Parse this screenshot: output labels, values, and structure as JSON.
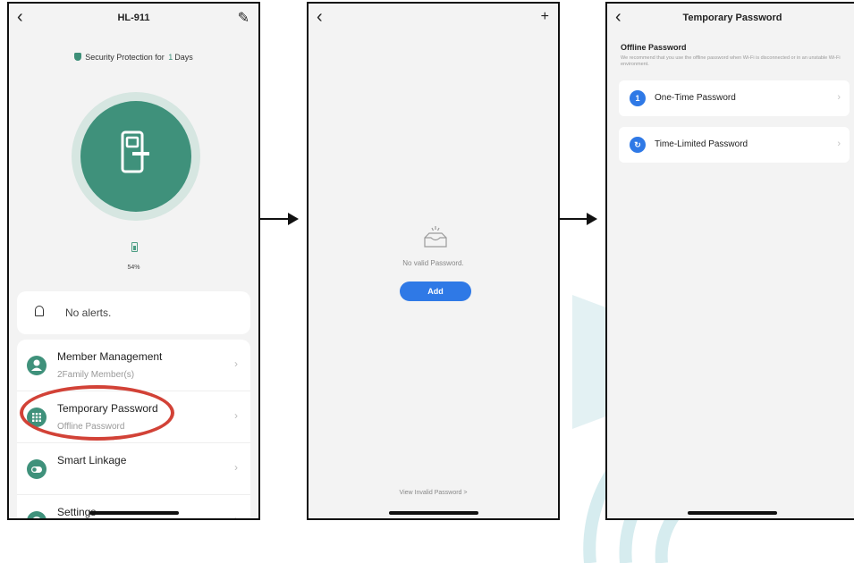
{
  "screen1": {
    "title": "HL-911",
    "security_prefix": "Security Protection for",
    "security_days": "1",
    "security_suffix": "Days",
    "battery": "54%",
    "alerts": "No alerts.",
    "menu": [
      {
        "title": "Member Management",
        "subtitle": "2Family Member(s)",
        "icon": "person-icon"
      },
      {
        "title": "Temporary Password",
        "subtitle": "Offline Password",
        "icon": "keypad-icon"
      },
      {
        "title": "Smart Linkage",
        "subtitle": "",
        "icon": "toggle-icon"
      },
      {
        "title": "Settings",
        "subtitle": "",
        "icon": "gear-icon"
      }
    ]
  },
  "screen2": {
    "empty_text": "No valid Password.",
    "add_label": "Add",
    "view_invalid": "View Invalid Password >"
  },
  "screen3": {
    "title": "Temporary Password",
    "section_title": "Offline Password",
    "section_desc": "We recommend that you use the offline password when Wi-Fi is disconnected or in an unstable Wi-Fi environment.",
    "options": [
      {
        "badge": "1",
        "label": "One-Time Password"
      },
      {
        "badge": "↻",
        "label": "Time-Limited Password"
      }
    ]
  },
  "colors": {
    "accent_green": "#3f917b",
    "accent_blue": "#2f79e6",
    "highlight_red": "#d24237"
  }
}
